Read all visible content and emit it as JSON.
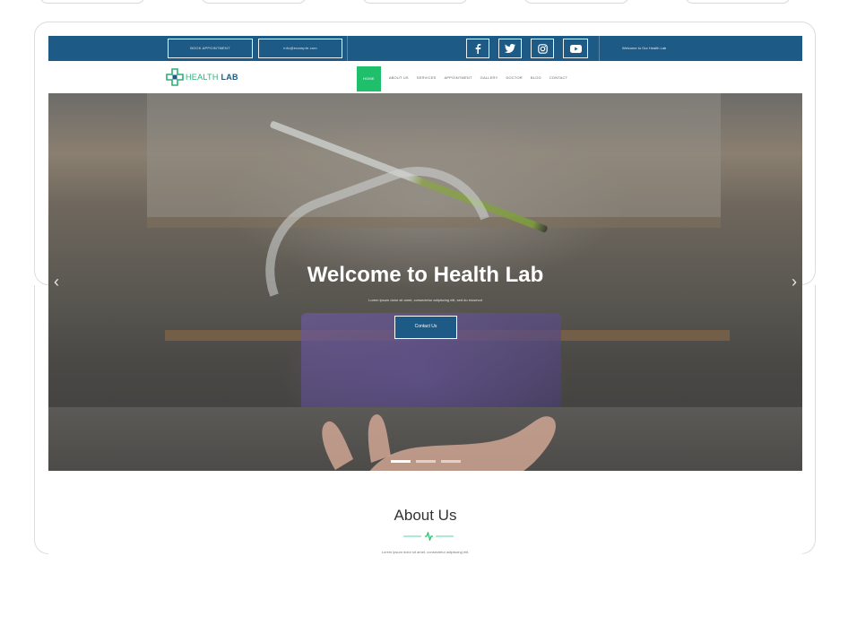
{
  "topbar": {
    "book_button": "BOOK APPOINTMENT",
    "email": "info@example.com",
    "social": [
      {
        "icon": "facebook-icon",
        "glyph": "f"
      },
      {
        "icon": "twitter-icon",
        "glyph": "t"
      },
      {
        "icon": "instagram-icon",
        "glyph": "i"
      },
      {
        "icon": "youtube-icon",
        "glyph": "y"
      }
    ],
    "welcome": "Welcome to Our Health Lab"
  },
  "logo": {
    "text_light": "HEALTH",
    "text_bold": "LAB"
  },
  "nav": {
    "items": [
      "HOME",
      "ABOUT US",
      "SERVICES",
      "APPOINTMENT",
      "GALLERY",
      "DOCTOR",
      "BLOG",
      "CONTACT"
    ],
    "active": "HOME"
  },
  "hero": {
    "title": "Welcome to Health Lab",
    "subtitle": "Lorem ipsum dolor sit amet, consectetur adipiscing elit, sed do eiusmod",
    "button": "Contact Us",
    "prev": "‹",
    "next": "›",
    "slides": 3,
    "active_slide": 1
  },
  "about": {
    "title": "About Us",
    "text": "Lorem ipsum dolor sit amet, consectetur adipiscing elit."
  },
  "colors": {
    "brand_blue": "#1d5a86",
    "brand_green": "#20bf6b",
    "accent_teal": "#5ed4a6"
  }
}
